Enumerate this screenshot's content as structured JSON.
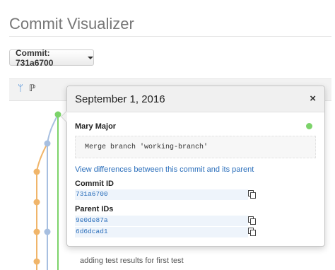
{
  "page": {
    "title": "Commit Visualizer"
  },
  "commit_selector": {
    "label": "Commit: 731a6700"
  },
  "toolbar": {
    "icons": [
      "branch-fork-icon",
      "branch-merge-icon"
    ]
  },
  "graph": {
    "colors": {
      "green": "#7cd36a",
      "blue": "#a7bfe0",
      "orange": "#f0b56a",
      "blue_line": "#a7bfe0"
    }
  },
  "log": {
    "visible_message": "adding test results for first test"
  },
  "popover": {
    "date": "September 1, 2016",
    "close_label": "×",
    "author": "Mary Major",
    "status_color": "#7cd36a",
    "message": "Merge branch 'working-branch'",
    "diff_link": "View differences between this commit and its parent",
    "commit_id_label": "Commit ID",
    "commit_id": "731a6700",
    "parent_ids_label": "Parent IDs",
    "parent_ids": [
      "9e0de87a",
      "6d6dcad1"
    ]
  }
}
